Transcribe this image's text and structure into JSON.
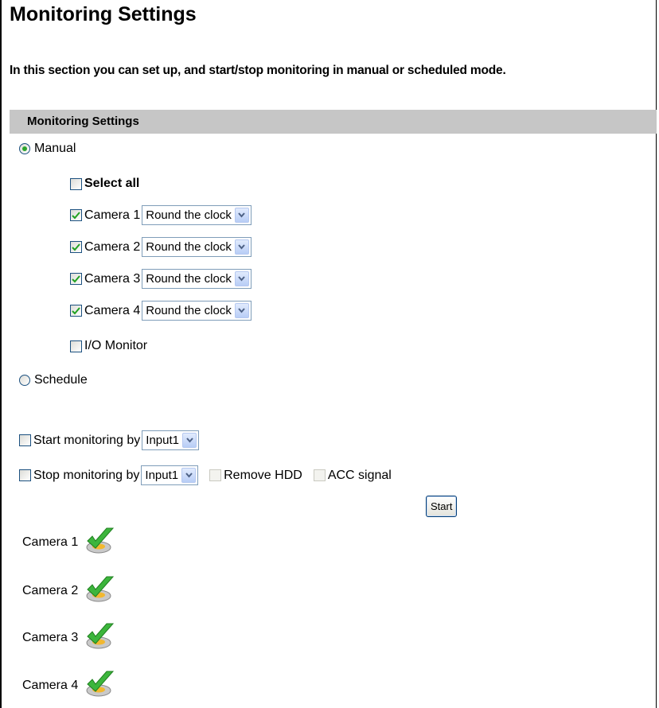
{
  "page": {
    "title": "Monitoring Settings",
    "intro": "In this section you can set up, and start/stop monitoring in manual or scheduled mode."
  },
  "section": {
    "header": "Monitoring Settings"
  },
  "mode": {
    "manual_label": "Manual",
    "manual_selected": true,
    "schedule_label": "Schedule",
    "schedule_selected": false
  },
  "manual": {
    "select_all_label": "Select all",
    "select_all_checked": false,
    "cameras": [
      {
        "label": "Camera 1",
        "checked": true,
        "schedule": "Round the clock"
      },
      {
        "label": "Camera 2",
        "checked": true,
        "schedule": "Round the clock"
      },
      {
        "label": "Camera 3",
        "checked": true,
        "schedule": "Round the clock"
      },
      {
        "label": "Camera 4",
        "checked": true,
        "schedule": "Round the clock"
      }
    ],
    "io_monitor_label": "I/O Monitor",
    "io_monitor_checked": false
  },
  "triggers": {
    "start_label": "Start monitoring by",
    "start_input": "Input1",
    "stop_label": "Stop monitoring by",
    "stop_input": "Input1",
    "remove_hdd_label": "Remove HDD",
    "acc_signal_label": "ACC signal"
  },
  "start_button": "Start",
  "status": [
    {
      "label": "Camera 1",
      "icon": "check-disk-icon"
    },
    {
      "label": "Camera 2",
      "icon": "check-disk-icon"
    },
    {
      "label": "Camera 3",
      "icon": "check-disk-icon"
    },
    {
      "label": "Camera 4",
      "icon": "check-disk-icon"
    }
  ],
  "colors": {
    "header_bg": "#c6c6c6",
    "check_green": "#21a121",
    "control_border": "#1c5180"
  }
}
